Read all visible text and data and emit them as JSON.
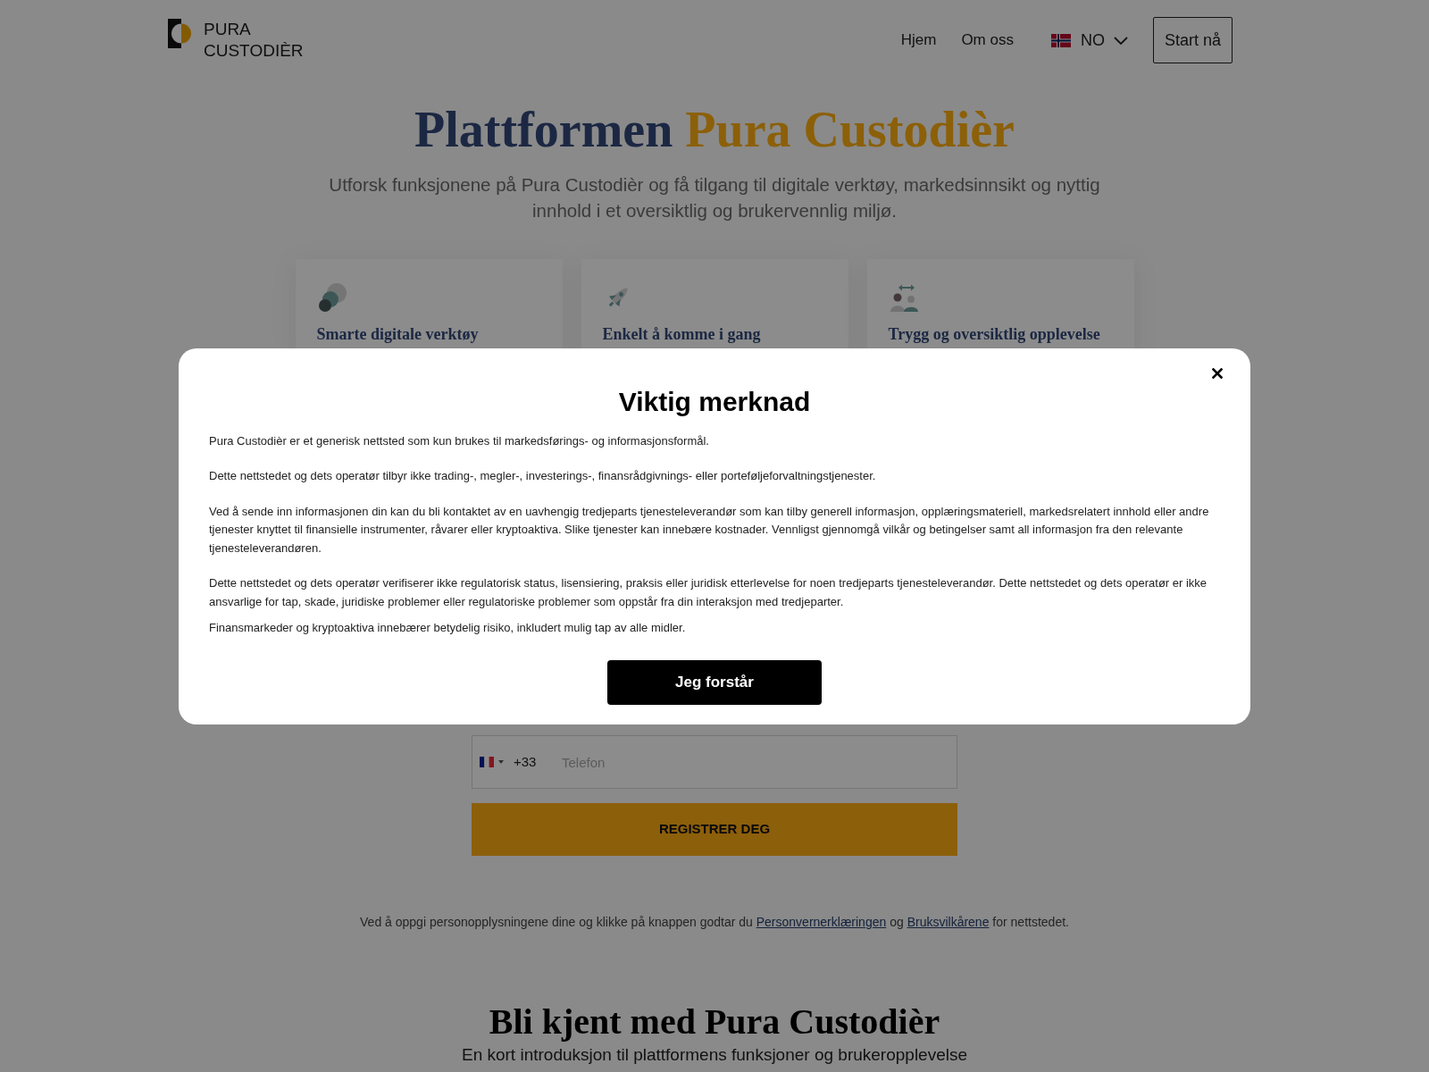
{
  "header": {
    "logo": {
      "lines": [
        "PURA",
        "CUSTODIÈR"
      ]
    },
    "nav": [
      {
        "label": "Hjem"
      },
      {
        "label": "Om oss"
      }
    ],
    "language": {
      "code": "NO"
    },
    "cta": "Start nå"
  },
  "hero": {
    "title": [
      {
        "text": "Plattformen",
        "kind": "plain"
      },
      {
        "text": "Pura Custodièr",
        "kind": "accent"
      }
    ],
    "subtitle": "Utforsk funksjonene på Pura Custodièr og få tilgang til digitale verktøy, markedsinnsikt og nyttig innhold i et oversiktlig og brukervennlig miljø."
  },
  "features": [
    {
      "title": "Smarte digitale verktøy"
    },
    {
      "title": "Enkelt å komme i gang"
    },
    {
      "title": "Trygg og oversiktlig opplevelse"
    }
  ],
  "form": {
    "phone": {
      "dial_code": "+33",
      "placeholder": "Telefon"
    },
    "submit": "REGISTRER DEG"
  },
  "consent": [
    {
      "kind": "text",
      "text": "Ved å oppgi personopplysningene dine og klikke på knappen godtar du"
    },
    {
      "kind": "link",
      "text": "Personvernerklæringen"
    },
    {
      "kind": "text",
      "text": "og"
    },
    {
      "kind": "link",
      "text": "Bruksvilkårene"
    },
    {
      "kind": "text",
      "text": "for nettstedet."
    }
  ],
  "about": {
    "title": "Bli kjent med Pura Custodièr",
    "subtitle": "En kort introduksjon til plattformens funksjoner og brukeropplevelse"
  },
  "modal": {
    "title": "Viktig merknad",
    "paragraphs": [
      "Pura Custodièr er et generisk nettsted som kun brukes til markedsførings- og informasjonsformål.",
      "Dette nettstedet og dets operatør tilbyr ikke trading-, megler-, investerings-, finansrådgivnings- eller porteføljeforvaltningstjenester.",
      "Ved å sende inn informasjonen din kan du bli kontaktet av en uavhengig tredjeparts tjenesteleverandør som kan tilby generell informasjon, opplæringsmateriell, markedsrelatert innhold eller andre tjenester knyttet til finansielle instrumenter, råvarer eller kryptoaktiva. Slike tjenester kan innebære kostnader. Vennligst gjennomgå vilkår og betingelser samt all informasjon fra den relevante tjenesteleverandøren.",
      "Dette nettstedet og dets operatør verifiserer ikke regulatorisk status, lisensiering, praksis eller juridisk etterlevelse for noen tredjeparts tjenesteleverandør. Dette nettstedet og dets operatør er ikke ansvarlige for tap, skade, juridiske problemer eller regulatoriske problemer som oppstår fra din interaksjon med tredjeparter.",
      "Finansmarkeder og kryptoaktiva innebærer betydelig risiko, inkludert mulig tap av alle midler."
    ],
    "button": "Jeg forstår"
  }
}
